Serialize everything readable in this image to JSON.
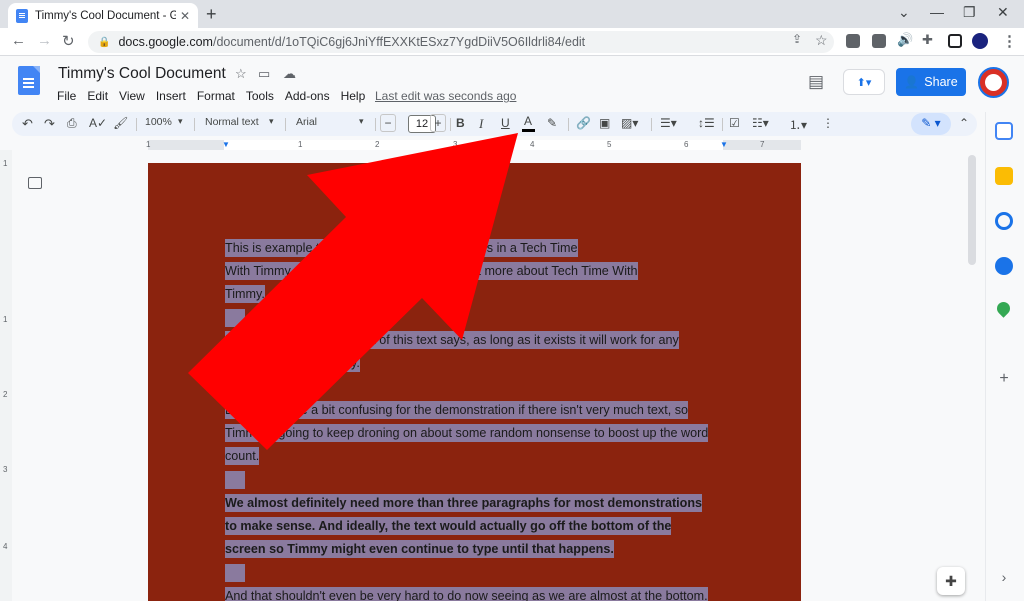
{
  "browser": {
    "tab_title": "Timmy's Cool Document - Googl",
    "tab_close": "✕",
    "new_tab": "+",
    "url_domain": "docs.google.com",
    "url_path": "/document/d/1oTQiC6gj6JniYffEXXKtESxz7YgdDiiV5O6Ildrli84/edit",
    "win_min": "⌄",
    "win_minimize": "—",
    "win_restore": "❐",
    "win_close": "✕"
  },
  "docs": {
    "title": "Timmy's Cool Document",
    "menu": [
      "File",
      "Edit",
      "View",
      "Insert",
      "Format",
      "Tools",
      "Add-ons",
      "Help"
    ],
    "last_edit": "Last edit was seconds ago",
    "share_label": "Share"
  },
  "toolbar": {
    "zoom": "100%",
    "style": "Normal text",
    "font": "Arial",
    "font_size": "12",
    "bold": "B",
    "italic": "I",
    "underline": "U",
    "text_color": "A",
    "minus": "−",
    "plus": "+"
  },
  "ruler": {
    "numbers": [
      "1",
      "1",
      "2",
      "3",
      "4",
      "5",
      "6",
      "7"
    ],
    "vertical": [
      "1",
      "1",
      "2",
      "3",
      "4"
    ]
  },
  "document": {
    "paragraphs": [
      {
        "lines": [
          "This is example text for demonstration purposes in a Tech Time",
          "With Timmy video. Visit the website to find out more about Tech Time With",
          "Timmy."
        ],
        "bold": false
      },
      {
        "lines": [
          "It doesn't matter what most of this text says, as long as it exists it will work for any",
          "demonstrated summary."
        ],
        "bold": false
      },
      {
        "lines": [
          "But it would be a bit confusing for the demonstration if there isn't very much text, so",
          "Timmy is going to keep droning on about some random nonsense to boost up the word",
          "count."
        ],
        "bold": false
      },
      {
        "lines": [
          "We almost definitely need more than three paragraphs for most demonstrations",
          "to make sense.  And ideally, the text would actually go off the bottom of the",
          "screen so Timmy might even continue to type until that happens."
        ],
        "bold": true
      },
      {
        "lines": [
          "And that shouldn't even be very hard to do now seeing as we are almost at the bottom."
        ],
        "bold": false
      }
    ]
  },
  "colors": {
    "page_background": "#8b230e",
    "selection": "#8a7a9e",
    "arrow": "#ff0000",
    "share_button": "#1a73e8"
  }
}
